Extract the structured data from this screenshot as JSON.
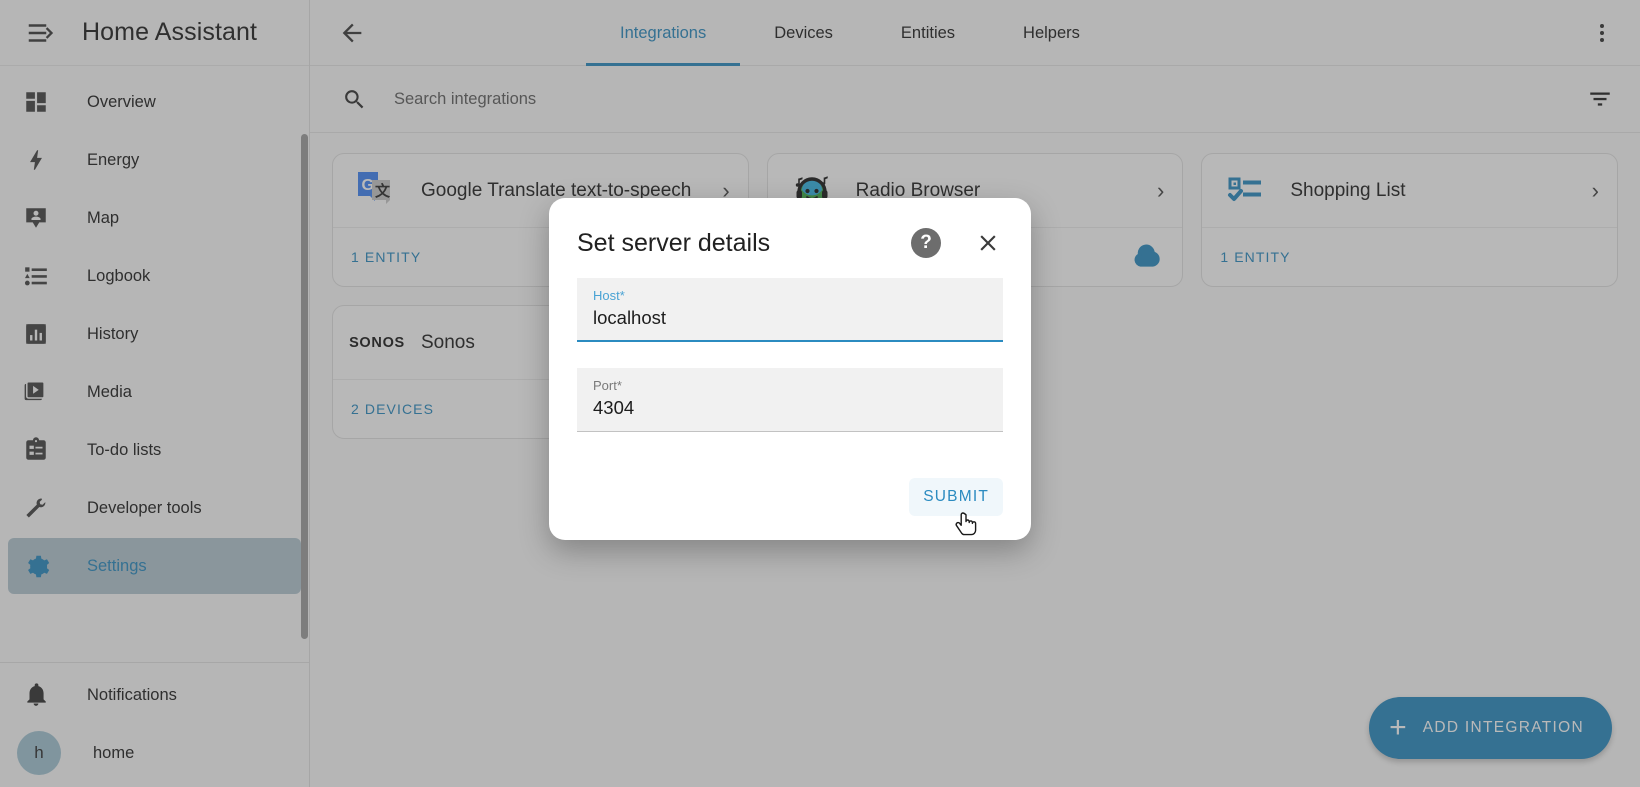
{
  "app": {
    "title": "Home Assistant",
    "accent_color": "#2b8bc0",
    "menu_icon": "menu-collapse-icon"
  },
  "sidebar": {
    "items": [
      {
        "label": "Overview",
        "icon": "dashboard-icon",
        "active": false
      },
      {
        "label": "Energy",
        "icon": "lightning-bolt-icon",
        "active": false
      },
      {
        "label": "Map",
        "icon": "map-marker-account-icon",
        "active": false
      },
      {
        "label": "Logbook",
        "icon": "format-list-icon",
        "active": false
      },
      {
        "label": "History",
        "icon": "chart-box-icon",
        "active": false
      },
      {
        "label": "Media",
        "icon": "play-box-multiple-icon",
        "active": false
      },
      {
        "label": "To-do lists",
        "icon": "clipboard-list-icon",
        "active": false
      },
      {
        "label": "Developer tools",
        "icon": "hammer-wrench-icon",
        "active": false
      },
      {
        "label": "Settings",
        "icon": "cog-icon",
        "active": true
      }
    ],
    "bottom_items": [
      {
        "label": "Notifications",
        "icon": "bell-icon"
      }
    ],
    "profile": {
      "label": "home",
      "initial": "h"
    }
  },
  "toolbar": {
    "back_icon": "arrow-left-icon",
    "overflow_icon": "dots-vertical-icon",
    "tabs": [
      {
        "label": "Integrations",
        "active": true
      },
      {
        "label": "Devices",
        "active": false
      },
      {
        "label": "Entities",
        "active": false
      },
      {
        "label": "Helpers",
        "active": false
      }
    ]
  },
  "search": {
    "placeholder": "Search integrations",
    "value": "",
    "icon": "search-icon",
    "filter_icon": "filter-variant-icon"
  },
  "integrations": [
    {
      "name": "Google Translate text-to-speech",
      "logo": "google-translate-logo",
      "footer_label": "1 ENTITY",
      "has_cloud_badge": false,
      "chevron": "chevron-right-icon"
    },
    {
      "name": "Radio Browser",
      "logo": "radio-browser-logo",
      "footer_label": "",
      "has_cloud_badge": true,
      "chevron": "chevron-right-icon"
    },
    {
      "name": "Shopping List",
      "logo": "shopping-list-logo",
      "footer_label": "1 ENTITY",
      "has_cloud_badge": false,
      "chevron": "chevron-right-icon"
    },
    {
      "name": "Sonos",
      "logo": "sonos-logo",
      "logo_text": "SONOS",
      "footer_label": "2 DEVICES",
      "has_cloud_badge": false,
      "chevron": "chevron-right-icon"
    }
  ],
  "fab": {
    "label": "ADD INTEGRATION",
    "icon": "plus-icon"
  },
  "dialog": {
    "title": "Set server details",
    "help_icon": "help-circle-icon",
    "close_icon": "close-icon",
    "fields": [
      {
        "label": "Host*",
        "value": "localhost",
        "focused": true
      },
      {
        "label": "Port*",
        "value": "4304",
        "focused": false
      }
    ],
    "submit_label": "SUBMIT"
  }
}
